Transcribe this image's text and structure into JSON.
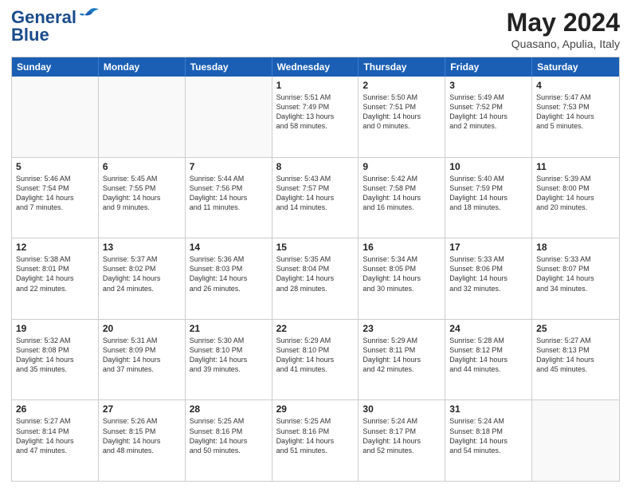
{
  "header": {
    "logo_line1": "General",
    "logo_line2": "Blue",
    "month": "May 2024",
    "location": "Quasano, Apulia, Italy"
  },
  "weekdays": [
    "Sunday",
    "Monday",
    "Tuesday",
    "Wednesday",
    "Thursday",
    "Friday",
    "Saturday"
  ],
  "rows": [
    [
      {
        "day": "",
        "info": ""
      },
      {
        "day": "",
        "info": ""
      },
      {
        "day": "",
        "info": ""
      },
      {
        "day": "1",
        "info": "Sunrise: 5:51 AM\nSunset: 7:49 PM\nDaylight: 13 hours\nand 58 minutes."
      },
      {
        "day": "2",
        "info": "Sunrise: 5:50 AM\nSunset: 7:51 PM\nDaylight: 14 hours\nand 0 minutes."
      },
      {
        "day": "3",
        "info": "Sunrise: 5:49 AM\nSunset: 7:52 PM\nDaylight: 14 hours\nand 2 minutes."
      },
      {
        "day": "4",
        "info": "Sunrise: 5:47 AM\nSunset: 7:53 PM\nDaylight: 14 hours\nand 5 minutes."
      }
    ],
    [
      {
        "day": "5",
        "info": "Sunrise: 5:46 AM\nSunset: 7:54 PM\nDaylight: 14 hours\nand 7 minutes."
      },
      {
        "day": "6",
        "info": "Sunrise: 5:45 AM\nSunset: 7:55 PM\nDaylight: 14 hours\nand 9 minutes."
      },
      {
        "day": "7",
        "info": "Sunrise: 5:44 AM\nSunset: 7:56 PM\nDaylight: 14 hours\nand 11 minutes."
      },
      {
        "day": "8",
        "info": "Sunrise: 5:43 AM\nSunset: 7:57 PM\nDaylight: 14 hours\nand 14 minutes."
      },
      {
        "day": "9",
        "info": "Sunrise: 5:42 AM\nSunset: 7:58 PM\nDaylight: 14 hours\nand 16 minutes."
      },
      {
        "day": "10",
        "info": "Sunrise: 5:40 AM\nSunset: 7:59 PM\nDaylight: 14 hours\nand 18 minutes."
      },
      {
        "day": "11",
        "info": "Sunrise: 5:39 AM\nSunset: 8:00 PM\nDaylight: 14 hours\nand 20 minutes."
      }
    ],
    [
      {
        "day": "12",
        "info": "Sunrise: 5:38 AM\nSunset: 8:01 PM\nDaylight: 14 hours\nand 22 minutes."
      },
      {
        "day": "13",
        "info": "Sunrise: 5:37 AM\nSunset: 8:02 PM\nDaylight: 14 hours\nand 24 minutes."
      },
      {
        "day": "14",
        "info": "Sunrise: 5:36 AM\nSunset: 8:03 PM\nDaylight: 14 hours\nand 26 minutes."
      },
      {
        "day": "15",
        "info": "Sunrise: 5:35 AM\nSunset: 8:04 PM\nDaylight: 14 hours\nand 28 minutes."
      },
      {
        "day": "16",
        "info": "Sunrise: 5:34 AM\nSunset: 8:05 PM\nDaylight: 14 hours\nand 30 minutes."
      },
      {
        "day": "17",
        "info": "Sunrise: 5:33 AM\nSunset: 8:06 PM\nDaylight: 14 hours\nand 32 minutes."
      },
      {
        "day": "18",
        "info": "Sunrise: 5:33 AM\nSunset: 8:07 PM\nDaylight: 14 hours\nand 34 minutes."
      }
    ],
    [
      {
        "day": "19",
        "info": "Sunrise: 5:32 AM\nSunset: 8:08 PM\nDaylight: 14 hours\nand 35 minutes."
      },
      {
        "day": "20",
        "info": "Sunrise: 5:31 AM\nSunset: 8:09 PM\nDaylight: 14 hours\nand 37 minutes."
      },
      {
        "day": "21",
        "info": "Sunrise: 5:30 AM\nSunset: 8:10 PM\nDaylight: 14 hours\nand 39 minutes."
      },
      {
        "day": "22",
        "info": "Sunrise: 5:29 AM\nSunset: 8:10 PM\nDaylight: 14 hours\nand 41 minutes."
      },
      {
        "day": "23",
        "info": "Sunrise: 5:29 AM\nSunset: 8:11 PM\nDaylight: 14 hours\nand 42 minutes."
      },
      {
        "day": "24",
        "info": "Sunrise: 5:28 AM\nSunset: 8:12 PM\nDaylight: 14 hours\nand 44 minutes."
      },
      {
        "day": "25",
        "info": "Sunrise: 5:27 AM\nSunset: 8:13 PM\nDaylight: 14 hours\nand 45 minutes."
      }
    ],
    [
      {
        "day": "26",
        "info": "Sunrise: 5:27 AM\nSunset: 8:14 PM\nDaylight: 14 hours\nand 47 minutes."
      },
      {
        "day": "27",
        "info": "Sunrise: 5:26 AM\nSunset: 8:15 PM\nDaylight: 14 hours\nand 48 minutes."
      },
      {
        "day": "28",
        "info": "Sunrise: 5:25 AM\nSunset: 8:16 PM\nDaylight: 14 hours\nand 50 minutes."
      },
      {
        "day": "29",
        "info": "Sunrise: 5:25 AM\nSunset: 8:16 PM\nDaylight: 14 hours\nand 51 minutes."
      },
      {
        "day": "30",
        "info": "Sunrise: 5:24 AM\nSunset: 8:17 PM\nDaylight: 14 hours\nand 52 minutes."
      },
      {
        "day": "31",
        "info": "Sunrise: 5:24 AM\nSunset: 8:18 PM\nDaylight: 14 hours\nand 54 minutes."
      },
      {
        "day": "",
        "info": ""
      }
    ]
  ]
}
